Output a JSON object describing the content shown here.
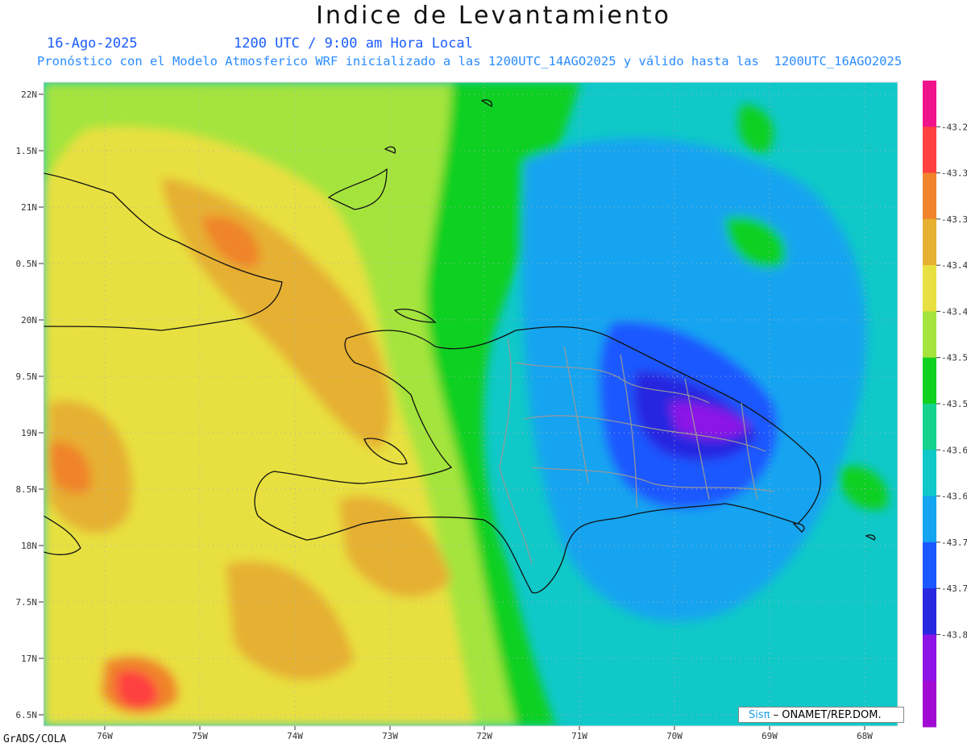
{
  "header": {
    "title": "Indice de Levantamiento",
    "date": "16-Ago-2025",
    "time": "1200 UTC / 9:00 am Hora Local",
    "description": "Pronóstico con el Modelo Atmosferico WRF inicializado a las 1200UTC_14AGO2025 y válido hasta las  1200UTC_16AGO2025"
  },
  "footer": {
    "credit": "GrADS/COLA",
    "logo_sis": "Sisπ",
    "logo_text": "– ONAMET/REP.DOM."
  },
  "map": {
    "lon_range": [
      -76.35,
      -67.55
    ],
    "lat_range": [
      16.45,
      22.05
    ],
    "lat_labels": [
      "22N",
      "1.5N",
      "21N",
      "0.5N",
      "20N",
      "9.5N",
      "19N",
      "8.5N",
      "18N",
      "7.5N",
      "17N",
      "6.5N"
    ],
    "lon_labels": [
      "76W",
      "75W",
      "74W",
      "73W",
      "72W",
      "71W",
      "70W",
      "69W",
      "68W"
    ],
    "colorbar": {
      "colors": [
        "#f0148c",
        "#ff4040",
        "#f0842c",
        "#e6b030",
        "#e8e040",
        "#a4e43c",
        "#10d020",
        "#14d28c",
        "#10c8c8",
        "#14a4f0",
        "#1a58ff",
        "#2828e0",
        "#8c14e6",
        "#a00ad2"
      ],
      "labels": [
        "-43.2",
        "-43.3",
        "-43.3",
        "-43.4",
        "-43.4",
        "-43.5",
        "-43.5",
        "-43.6",
        "-43.6",
        "-43.7",
        "-43.7",
        "-43.8"
      ]
    }
  }
}
